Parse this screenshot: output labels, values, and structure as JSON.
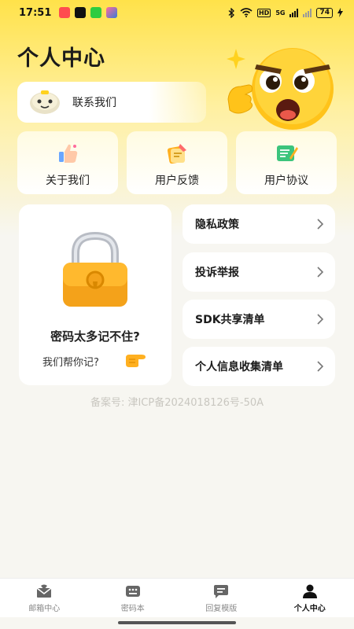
{
  "status_bar": {
    "time": "17:51",
    "network": "HD",
    "signal_label": "5G",
    "battery": "74",
    "app_icon_colors": [
      "#ff4d4f",
      "#111111",
      "#2ecc40",
      "#3a7bd5"
    ]
  },
  "header": {
    "title": "个人中心",
    "contact_label": "联系我们"
  },
  "quick_cards": [
    {
      "label": "关于我们",
      "icon": "thumbs-up-icon"
    },
    {
      "label": "用户反馈",
      "icon": "feedback-icon"
    },
    {
      "label": "用户协议",
      "icon": "agreement-icon"
    }
  ],
  "password_card": {
    "title": "密码太多记不住?",
    "subtitle": "我们帮你记?",
    "icon": "padlock-icon"
  },
  "menu": [
    {
      "label": "隐私政策"
    },
    {
      "label": "投诉举报"
    },
    {
      "label": "SDK共享清单"
    },
    {
      "label": "个人信息收集清单"
    }
  ],
  "icp": "备案号: 津ICP备2024018126号-50A",
  "bottom_nav": [
    {
      "label": "邮箱中心",
      "icon": "mailbox-icon",
      "active": false
    },
    {
      "label": "密码本",
      "icon": "password-book-icon",
      "active": false
    },
    {
      "label": "回复模版",
      "icon": "reply-template-icon",
      "active": false
    },
    {
      "label": "个人中心",
      "icon": "person-icon",
      "active": true
    }
  ],
  "colors": {
    "accent_yellow": "#ffe24a",
    "background": "#f7f6f1",
    "active_nav": "#111111",
    "inactive_nav": "#888888"
  }
}
